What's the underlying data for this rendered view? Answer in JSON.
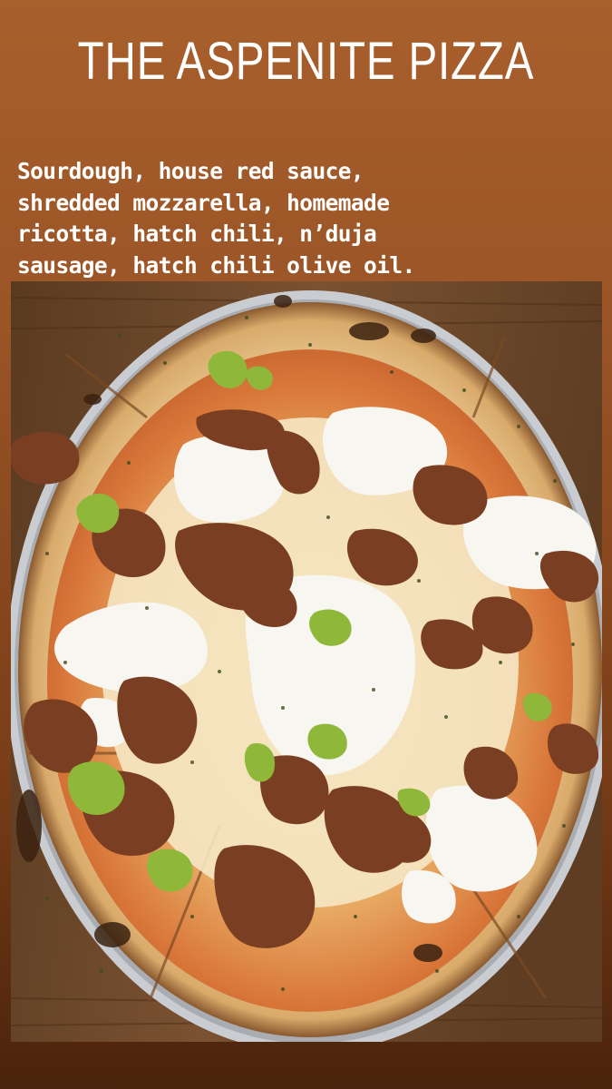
{
  "story": {
    "title": "THE ASPENITE PIZZA",
    "caption_lines": [
      "Sourdough, house red sauce,",
      "shredded mozzarella, homemade",
      "ricotta, hatch chili, n’duja",
      "sausage, hatch chili olive oil."
    ]
  },
  "colors": {
    "background_top": "#a85f2c",
    "background_bottom": "#4a230c",
    "text": "#ffffff",
    "crust": "#e8c48a",
    "ricotta": "#f7f5ef",
    "sausage": "#7a3f22",
    "hatch_chili": "#8fb83a"
  }
}
